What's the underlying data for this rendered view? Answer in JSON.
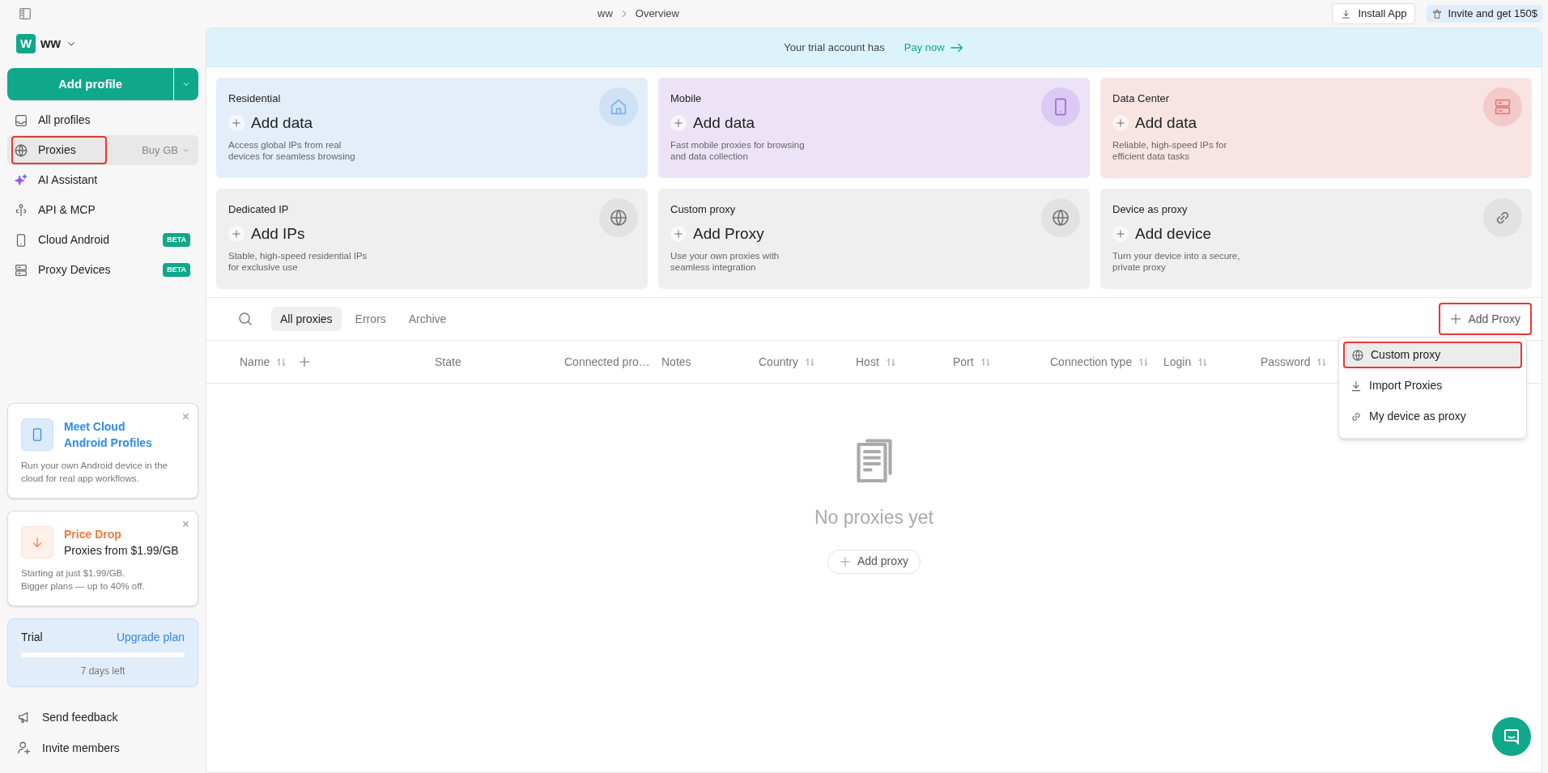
{
  "breadcrumb": [
    "ww",
    "Overview"
  ],
  "top_buttons": [
    {
      "kind": "install",
      "label": "Install App"
    },
    {
      "kind": "invite",
      "label": "Invite and get 150$"
    }
  ],
  "workspace": {
    "initial": "W",
    "name": "ww"
  },
  "add_profile": {
    "label": "Add profile"
  },
  "sidebar": {
    "items": [
      {
        "label": "All profiles",
        "selected": false,
        "highlighted": false
      },
      {
        "label": "Proxies",
        "selected": true,
        "highlighted": true,
        "extra": "Buy GB"
      },
      {
        "label": "AI Assistant",
        "selected": false,
        "highlighted": false
      },
      {
        "label": "API & MCP",
        "selected": false,
        "highlighted": false
      },
      {
        "label": "Cloud Android",
        "selected": false,
        "highlighted": false,
        "badge": "BETA"
      },
      {
        "label": "Proxy Devices",
        "selected": false,
        "highlighted": false,
        "badge": "BETA"
      }
    ]
  },
  "promos": [
    {
      "kind": "cloud",
      "title": [
        "Meet Cloud",
        "Android Profiles"
      ],
      "text": [
        "Run your own Android device in the",
        "cloud for real app workflows."
      ],
      "close": "×"
    },
    {
      "kind": "price",
      "title": [
        "Price Drop"
      ],
      "subtitle": "Proxies from $1.99/GB",
      "text": [
        "Starting at just $1.99/GB.",
        "Bigger plans — up to 40% off."
      ],
      "close": "×"
    }
  ],
  "trial": {
    "label": "Trial",
    "link": "Upgrade plan",
    "level": 0.0,
    "days": "7 days left"
  },
  "sidebar_footer": [
    {
      "label": "Send feedback"
    },
    {
      "label": "Invite members"
    }
  ],
  "banner": {
    "text": "Your trial account has",
    "link": "Pay now"
  },
  "cards": [
    {
      "kind": "residential",
      "title": "Residential",
      "action": "Add data",
      "description": [
        "Access global IPs from real",
        "devices for seamless browsing"
      ]
    },
    {
      "kind": "mobile",
      "title": "Mobile",
      "action": "Add data",
      "description": [
        "Fast mobile proxies for browsing",
        "and data collection"
      ]
    },
    {
      "kind": "datacenter",
      "title": "Data Center",
      "action": "Add data",
      "description": [
        "Reliable, high-speed IPs for",
        "efficient data tasks"
      ]
    },
    {
      "kind": "dedicated",
      "title": "Dedicated IP",
      "action": "Add IPs",
      "description": [
        "Stable, high-speed residential IPs",
        "for exclusive use"
      ]
    },
    {
      "kind": "custom",
      "title": "Custom proxy",
      "action": "Add Proxy",
      "description": [
        "Use your own proxies with",
        "seamless integration"
      ]
    },
    {
      "kind": "device",
      "title": "Device as proxy",
      "action": "Add device",
      "description": [
        "Turn your device into a secure,",
        "private proxy"
      ]
    }
  ],
  "tabs": [
    {
      "label": "All proxies",
      "selected": true
    },
    {
      "label": "Errors",
      "selected": false
    },
    {
      "label": "Archive",
      "selected": false
    }
  ],
  "add_proxy_button": {
    "label": "Add Proxy",
    "highlighted": true
  },
  "table": {
    "columns": [
      {
        "label": "Name",
        "sortable": true,
        "addable": true
      },
      {
        "label": "State",
        "sortable": false
      },
      {
        "label": "Connected pro…",
        "sortable": false
      },
      {
        "label": "Notes",
        "sortable": false
      },
      {
        "label": "Country",
        "sortable": true
      },
      {
        "label": "Host",
        "sortable": true
      },
      {
        "label": "Port",
        "sortable": true
      },
      {
        "label": "Connection type",
        "sortable": true
      },
      {
        "label": "Login",
        "sortable": true
      },
      {
        "label": "Password",
        "sortable": true
      }
    ]
  },
  "menu": {
    "items": [
      {
        "label": "Custom proxy",
        "selected": true,
        "highlighted": true
      },
      {
        "label": "Import Proxies",
        "selected": false,
        "highlighted": false
      },
      {
        "label": "My device as proxy",
        "selected": false,
        "highlighted": false
      }
    ]
  },
  "empty_state": {
    "text": "No proxies yet",
    "button": "Add proxy"
  }
}
